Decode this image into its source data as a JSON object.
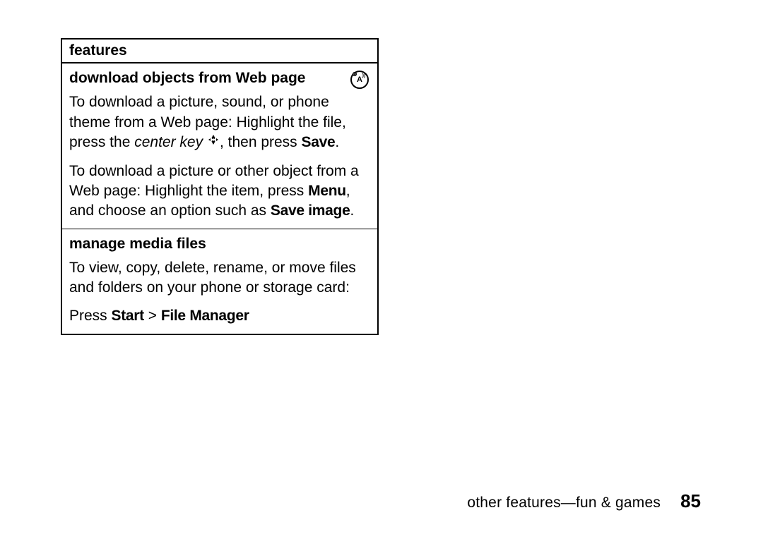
{
  "header": {
    "title": "features"
  },
  "section1": {
    "title": "download objects from Web page",
    "p1a": "To download a picture, sound, or phone theme from a Web page: Highlight the file, press the ",
    "p1b_italic": "center key",
    "p1c": " ",
    "p1d": ", then press ",
    "p1e_bold": "Save",
    "p1f": ".",
    "p2a": "To download a picture or other object from a Web page: Highlight the item, press ",
    "p2b_bold": "Menu",
    "p2c": ", and choose an option such as ",
    "p2d_bold": "Save image",
    "p2e": "."
  },
  "section2": {
    "title": "manage media files",
    "p1": "To view, copy, delete, rename, or move files and folders on your phone or storage card:",
    "p2a": "Press ",
    "p2b_bold": "Start",
    "p2c": " > ",
    "p2d_bold": "File Manager"
  },
  "footer": {
    "text": "other features—fun & games",
    "page_number": "85"
  }
}
